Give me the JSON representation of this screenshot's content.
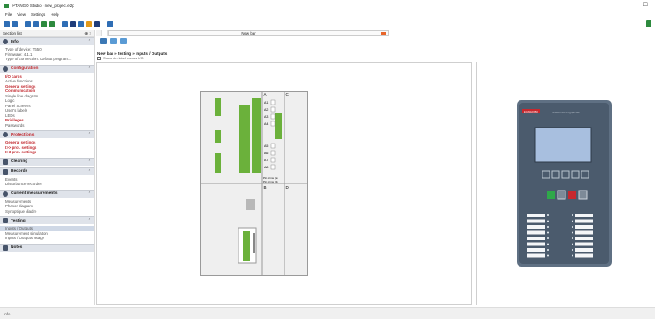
{
  "window": {
    "title": "e²TANGO Studio - new_project.e2p",
    "minimize": "—",
    "maximize": "☐"
  },
  "menu": [
    "File",
    "View",
    "Settings",
    "Help"
  ],
  "toolbar": {
    "colors": [
      "#2f6eb5",
      "#2f6eb5",
      "#2f6eb5",
      "#2f6eb5",
      "#2d8a3e",
      "#2d8a3e",
      "#2f6eb5",
      "#1f3d7a",
      "#2f6eb5",
      "#e29a1b",
      "#1f3d7a",
      "#2f6eb5"
    ]
  },
  "sidebar": {
    "title": "Section list",
    "pin": "⊕ ×",
    "sections": [
      {
        "label": "Info",
        "red": false,
        "items": [
          {
            "t": "Type of device: T650"
          },
          {
            "t": "Firmware: 4.1.1"
          },
          {
            "t": "Type of connection: Default program..."
          }
        ]
      },
      {
        "label": "Configuration",
        "red": true,
        "items": [
          {
            "t": "I/O cards",
            "r": true
          },
          {
            "t": "Active functions"
          },
          {
            "t": "General settings",
            "r": true
          },
          {
            "t": "Communication",
            "r": true
          },
          {
            "t": "Single line diagram"
          },
          {
            "t": "Logic"
          },
          {
            "t": "Panel Screens"
          },
          {
            "t": "User's labels"
          },
          {
            "t": "LEDs"
          },
          {
            "t": "Privileges",
            "r": true
          },
          {
            "t": "Passwords"
          }
        ]
      },
      {
        "label": "Protections",
        "red": true,
        "items": [
          {
            "t": "General settings",
            "r": true
          },
          {
            "t": "I>> prot. settings",
            "r": true
          },
          {
            "t": "I>3 prot. settings",
            "r": true
          }
        ]
      },
      {
        "label": "Clearing",
        "red": false,
        "items": []
      },
      {
        "label": "Records",
        "red": false,
        "items": [
          {
            "t": "Events"
          },
          {
            "t": "Disturbance recorder"
          }
        ]
      },
      {
        "label": "Current measurements",
        "red": false,
        "items": [
          {
            "t": "Measurements"
          },
          {
            "t": "Phasor diagram"
          },
          {
            "t": "Synoptique diadre"
          }
        ]
      },
      {
        "label": "Testing",
        "red": false,
        "items": [
          {
            "t": "Inputs / Outputs",
            "s": true
          },
          {
            "t": "Measurement simulation"
          },
          {
            "t": "Inputs / Outputs usage"
          }
        ]
      },
      {
        "label": "Notes",
        "red": false,
        "items": []
      }
    ]
  },
  "tabs": {
    "first": "",
    "active": "New bar"
  },
  "main": {
    "breadcrumb": "New bar » testing » Inputs / Outputs",
    "show_label": "Show pin label names I/O"
  },
  "io_panel": {
    "col_a": "A",
    "col_c": "C",
    "col_b": "B",
    "col_d": "D",
    "rows": [
      "A1",
      "A2",
      "A3",
      "A4",
      "A5",
      "A6",
      "A7",
      "A8"
    ],
    "notes": [
      "Pin Arms (2)",
      "Pin Arms (1)"
    ]
  },
  "relay": {
    "brand": "ETANGO 650",
    "logo": "elektrometal energetyka SA"
  },
  "status": {
    "text": "Info"
  }
}
